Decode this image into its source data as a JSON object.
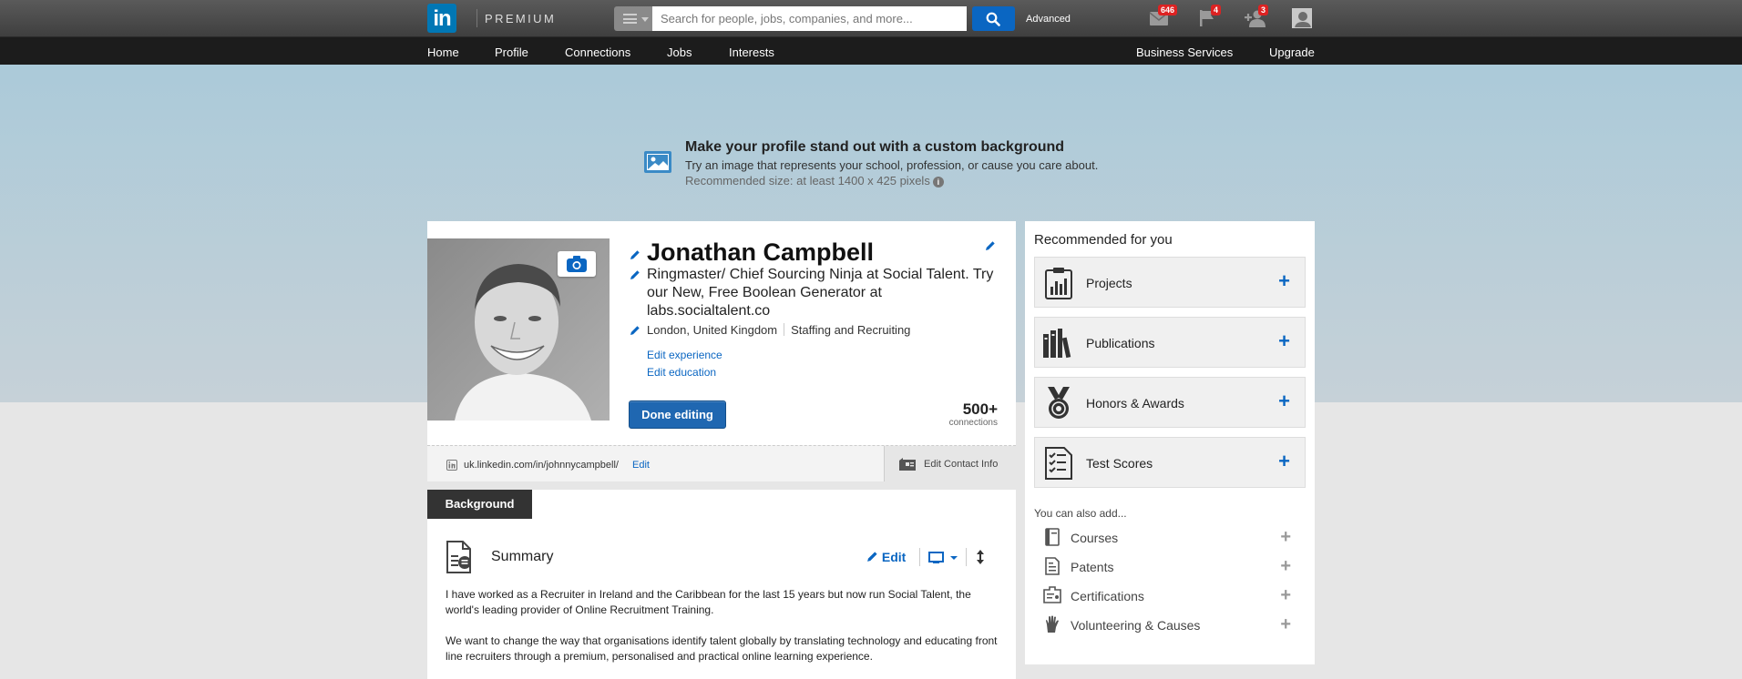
{
  "topbar": {
    "logo": "in",
    "premium": "PREMIUM",
    "search_placeholder": "Search for people, jobs, companies, and more...",
    "advanced": "Advanced",
    "badges": {
      "messages": "646",
      "notifications": "4",
      "invitations": "3"
    }
  },
  "nav": {
    "left": [
      "Home",
      "Profile",
      "Connections",
      "Jobs",
      "Interests"
    ],
    "right": [
      "Business Services",
      "Upgrade"
    ]
  },
  "hero": {
    "title": "Make your profile stand out with a custom background",
    "subtitle": "Try an image that represents your school, profession, or cause you care about.",
    "recommended": "Recommended size: at least 1400 x 425 pixels"
  },
  "profile": {
    "name": "Jonathan Campbell",
    "headline": "Ringmaster/ Chief Sourcing Ninja at Social Talent. Try our New, Free Boolean Generator at labs.socialtalent.co",
    "location": "London, United Kingdom",
    "industry": "Staffing and Recruiting",
    "edit_experience": "Edit experience",
    "edit_education": "Edit education",
    "done_button": "Done editing",
    "connections_count": "500+",
    "connections_label": "connections",
    "public_url": "uk.linkedin.com/in/johnnycampbell/",
    "url_edit": "Edit",
    "edit_contact": "Edit Contact Info"
  },
  "background": {
    "tab": "Background",
    "summary_title": "Summary",
    "summary_edit": "Edit",
    "summary_p1": "I have worked as a Recruiter in Ireland and the Caribbean for the last 15 years but now run Social Talent, the world's leading provider of Online Recruitment Training.",
    "summary_p2": "We want to change the way that organisations identify talent globally by translating technology and educating front line recruiters through a premium, personalised and practical online learning experience."
  },
  "rail": {
    "title": "Recommended for you",
    "recommended": [
      {
        "label": "Projects",
        "icon": "clipboard-icon"
      },
      {
        "label": "Publications",
        "icon": "books-icon"
      },
      {
        "label": "Honors & Awards",
        "icon": "medal-icon"
      },
      {
        "label": "Test Scores",
        "icon": "checklist-icon"
      }
    ],
    "also_title": "You can also add...",
    "also": [
      {
        "label": "Courses",
        "icon": "course-book-icon"
      },
      {
        "label": "Patents",
        "icon": "patent-doc-icon"
      },
      {
        "label": "Certifications",
        "icon": "certificate-icon"
      },
      {
        "label": "Volunteering & Causes",
        "icon": "hand-icon"
      }
    ]
  },
  "colors": {
    "accent": "#0a66c2",
    "topbar": "#4a4a4a",
    "navbar": "#1c1c1c",
    "hero": "#abcad9"
  }
}
